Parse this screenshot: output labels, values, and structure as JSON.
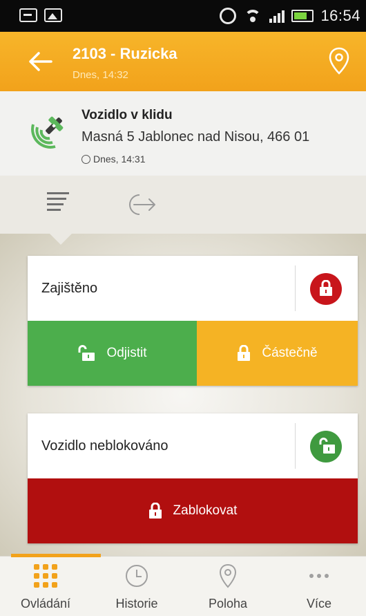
{
  "status_bar": {
    "time": "16:54",
    "icons": [
      "message-icon",
      "image-icon",
      "alarm-icon",
      "wifi-icon",
      "signal-icon",
      "battery-icon"
    ]
  },
  "header": {
    "title": "2103 - Ruzicka",
    "subtitle": "Dnes, 14:32",
    "icons": [
      "back-arrow-icon",
      "location-pin-icon"
    ]
  },
  "vehicle_info": {
    "status": "Vozidlo v klidu",
    "address": "Masná 5 Jablonec nad Nisou, 466 01",
    "timestamp": "Dnes, 14:31",
    "icons": [
      "satellite-icon",
      "clock-icon"
    ]
  },
  "tabs": {
    "icons": [
      "list-icon",
      "exit-icon"
    ],
    "active": "list"
  },
  "security_card": {
    "label": "Zajištěno",
    "state_icon": "lock-closed-icon",
    "state_color": "#c8151b",
    "buttons": [
      {
        "label": "Odjistit",
        "icon": "unlock-icon",
        "color": "#4cae4c"
      },
      {
        "label": "Částečně",
        "icon": "lock-icon",
        "color": "#f5b324"
      }
    ]
  },
  "block_card": {
    "label": "Vozidlo neblokováno",
    "state_icon": "lock-open-icon",
    "state_color": "#3f9a3f",
    "button": {
      "label": "Zablokovat",
      "icon": "lock-icon",
      "color": "#b10f0f"
    }
  },
  "bottom_nav": {
    "items": [
      {
        "label": "Ovládání",
        "icon": "grid-icon",
        "active": true
      },
      {
        "label": "Historie",
        "icon": "clock-icon",
        "active": false
      },
      {
        "label": "Poloha",
        "icon": "location-pin-icon",
        "active": false
      },
      {
        "label": "Více",
        "icon": "more-icon",
        "active": false
      }
    ],
    "accent": "#f2a21b"
  }
}
